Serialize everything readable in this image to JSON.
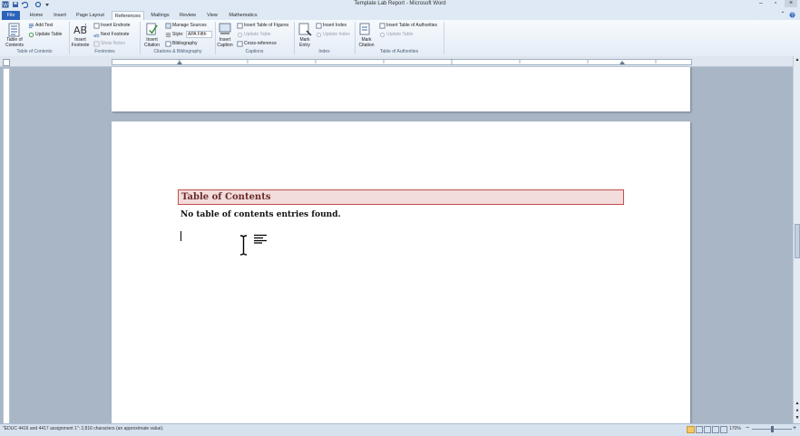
{
  "window": {
    "title": "Template Lab Report - Microsoft Word"
  },
  "tabs": [
    {
      "label": "File"
    },
    {
      "label": "Home"
    },
    {
      "label": "Insert"
    },
    {
      "label": "Page Layout"
    },
    {
      "label": "References"
    },
    {
      "label": "Mailings"
    },
    {
      "label": "Review"
    },
    {
      "label": "View"
    },
    {
      "label": "Mathematics"
    }
  ],
  "ribbon": {
    "toc": {
      "button": "Table of Contents",
      "add_text": "Add Text",
      "update_table": "Update Table",
      "group": "Table of Contents"
    },
    "footnotes": {
      "insert_footnote": "Insert Footnote",
      "insert_endnote": "Insert Endnote",
      "next_footnote": "Next Footnote",
      "show_notes": "Show Notes",
      "group": "Footnotes"
    },
    "citations": {
      "insert_citation": "Insert Citation",
      "manage_sources": "Manage Sources",
      "style_label": "Style:",
      "style_value": "APA Fifth",
      "bibliography": "Bibliography",
      "group": "Citations & Bibliography"
    },
    "captions": {
      "insert_caption": "Insert Caption",
      "insert_tof": "Insert Table of Figures",
      "update_table": "Update Table",
      "cross_reference": "Cross-reference",
      "group": "Captions"
    },
    "index": {
      "mark_entry": "Mark Entry",
      "insert_index": "Insert Index",
      "update_index": "Update Index",
      "group": "Index"
    },
    "authorities": {
      "mark_citation": "Mark Citation",
      "insert_toa": "Insert Table of Authorities",
      "update_table": "Update Table",
      "group": "Table of Authorities"
    }
  },
  "document": {
    "toc_heading": "Table of Contents",
    "toc_message": "No table of contents entries found."
  },
  "status": {
    "left": "\"EDUC 4416 and 4417 assignment 1\": 2,816 characters (an approximate value).",
    "zoom": "170%"
  },
  "colors": {
    "accent": "#2a63b8",
    "heading_fill": "#f2dcdc",
    "heading_border": "#c0504d"
  }
}
